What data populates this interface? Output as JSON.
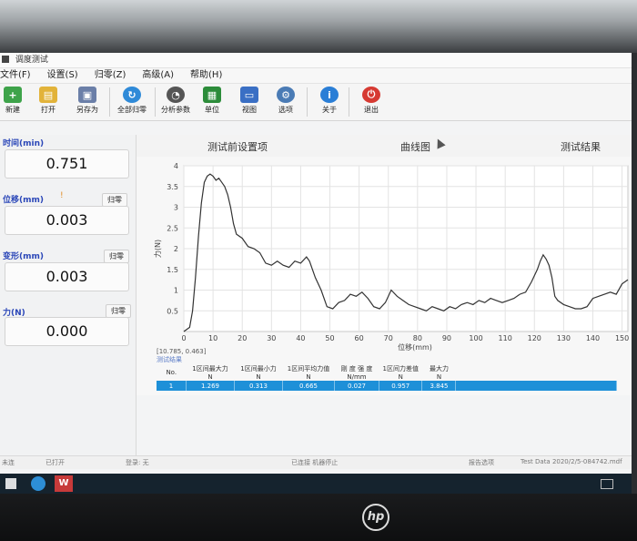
{
  "window": {
    "title": "调度测试"
  },
  "menu": [
    "文件(F)",
    "设置(S)",
    "归零(Z)",
    "高级(A)",
    "帮助(H)"
  ],
  "toolbar": {
    "new": "新建",
    "open": "打开",
    "save_as": "另存为",
    "zero_all": "全部归零",
    "analysis": "分析参数",
    "unit": "单位",
    "view": "视图",
    "options": "选项",
    "about": "关于",
    "exit": "退出"
  },
  "left_panel": {
    "time_label": "时间(min)",
    "time_value": "0.751",
    "disp_label": "位移(mm)",
    "disp_value": "0.003",
    "disp_zero": "归零",
    "deform_label": "变形(mm)",
    "deform_value": "0.003",
    "deform_zero": "归零",
    "force_label": "力(N)",
    "force_value": "0.000",
    "force_zero": "归零"
  },
  "tabs": [
    "测试前设置项",
    "曲线图",
    "测试结果"
  ],
  "chart_data": {
    "type": "line",
    "xlabel": "位移(mm)",
    "ylabel": "力(N)",
    "xlim": [
      0,
      152
    ],
    "ylim": [
      0,
      4
    ],
    "xticks": [
      0,
      10,
      20,
      30,
      40,
      50,
      60,
      70,
      80,
      90,
      100,
      110,
      120,
      130,
      140,
      150
    ],
    "yticks": [
      0.5,
      1,
      1.5,
      2,
      2.5,
      3,
      3.5,
      4
    ],
    "grid": true,
    "cursor_readout": "[10.785, 0.463]",
    "x": [
      0,
      2,
      3,
      4,
      5,
      6,
      7,
      8,
      9,
      10,
      11,
      12,
      13,
      14,
      15,
      16,
      17,
      18,
      20,
      22,
      24,
      26,
      28,
      30,
      32,
      34,
      36,
      38,
      40,
      42,
      43,
      45,
      47,
      49,
      51,
      53,
      55,
      57,
      59,
      61,
      63,
      65,
      67,
      69,
      71,
      73,
      75,
      77,
      79,
      81,
      83,
      85,
      87,
      89,
      91,
      93,
      95,
      97,
      99,
      101,
      103,
      105,
      107,
      109,
      111,
      113,
      115,
      117,
      119,
      121,
      122,
      123,
      124,
      125,
      126,
      127,
      128,
      130,
      132,
      134,
      136,
      138,
      140,
      142,
      144,
      146,
      148,
      150,
      152
    ],
    "y": [
      0,
      0.1,
      0.5,
      1.3,
      2.3,
      3.1,
      3.6,
      3.75,
      3.8,
      3.75,
      3.65,
      3.7,
      3.6,
      3.5,
      3.3,
      3.0,
      2.6,
      2.35,
      2.25,
      2.05,
      2.0,
      1.9,
      1.65,
      1.6,
      1.7,
      1.6,
      1.55,
      1.7,
      1.65,
      1.8,
      1.7,
      1.3,
      1.0,
      0.6,
      0.55,
      0.7,
      0.75,
      0.9,
      0.85,
      0.95,
      0.8,
      0.6,
      0.55,
      0.7,
      1.0,
      0.85,
      0.75,
      0.65,
      0.6,
      0.55,
      0.5,
      0.6,
      0.55,
      0.5,
      0.6,
      0.55,
      0.65,
      0.7,
      0.65,
      0.75,
      0.7,
      0.8,
      0.75,
      0.7,
      0.75,
      0.8,
      0.9,
      0.95,
      1.2,
      1.5,
      1.7,
      1.85,
      1.75,
      1.6,
      1.3,
      0.85,
      0.75,
      0.65,
      0.6,
      0.55,
      0.55,
      0.6,
      0.8,
      0.85,
      0.9,
      0.95,
      0.9,
      1.15,
      1.25
    ]
  },
  "results": {
    "title": "测试结果",
    "headers": [
      "No.",
      "1区间最大力\nN",
      "1区间最小力\nN",
      "1区间平均力值\nN",
      "刚 度 强 度\nN/mm",
      "1区间力差值\nN",
      "最大力\nN"
    ],
    "row": [
      "1",
      "1.269",
      "0.313",
      "0.665",
      "0.027",
      "0.957",
      "3.845"
    ]
  },
  "status": {
    "left1": "未连",
    "left2": "已打开",
    "left3": "登录: 无",
    "middle": "已连接  机器停止",
    "right1": "报告选项",
    "file": "Test Data 2020/2/5-084742.mdf"
  }
}
